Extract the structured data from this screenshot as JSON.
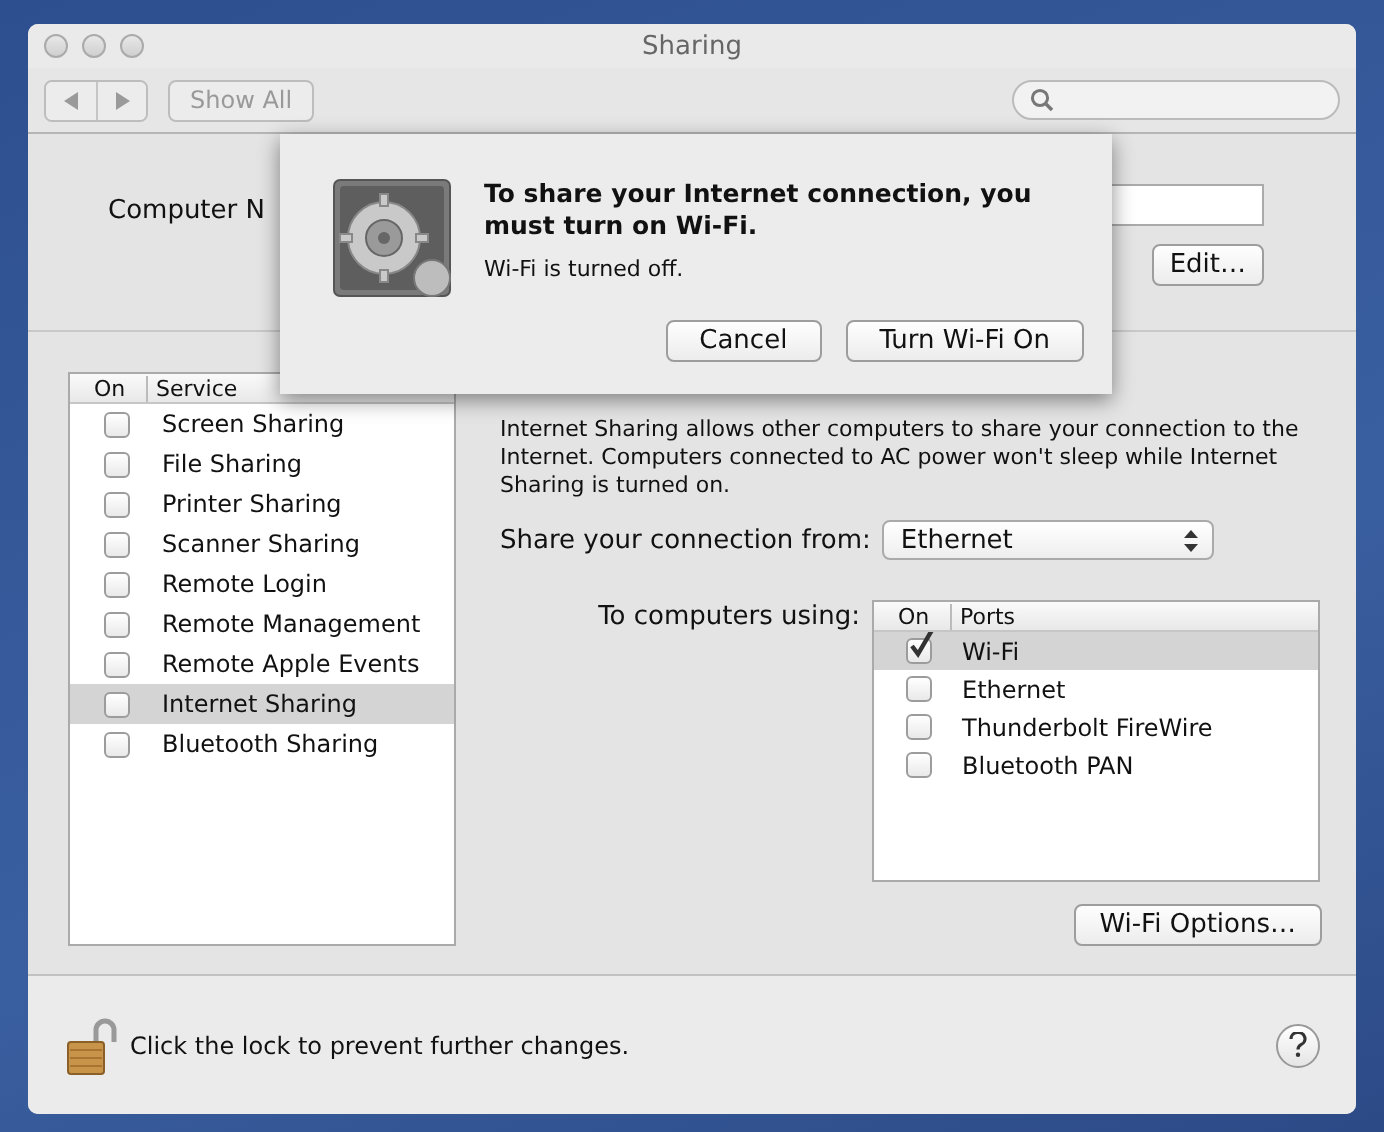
{
  "window": {
    "title": "Sharing"
  },
  "toolbar": {
    "show_all": "Show All"
  },
  "computer_name": {
    "label": "Computer N",
    "edit_button": "Edit…"
  },
  "alert": {
    "title": "To share your Internet connection, you must turn on Wi-Fi.",
    "message": "Wi-Fi is turned off.",
    "buttons": [
      {
        "label": "Cancel",
        "default": false
      },
      {
        "label": "Turn Wi-Fi On",
        "default": false
      }
    ]
  },
  "services": {
    "columns": [
      "On",
      "Service"
    ],
    "rows": [
      {
        "name": "Screen Sharing",
        "checked": false,
        "selected": false
      },
      {
        "name": "File Sharing",
        "checked": false,
        "selected": false
      },
      {
        "name": "Printer Sharing",
        "checked": false,
        "selected": false
      },
      {
        "name": "Scanner Sharing",
        "checked": false,
        "selected": false
      },
      {
        "name": "Remote Login",
        "checked": false,
        "selected": false
      },
      {
        "name": "Remote Management",
        "checked": false,
        "selected": false
      },
      {
        "name": "Remote Apple Events",
        "checked": false,
        "selected": false
      },
      {
        "name": "Internet Sharing",
        "checked": false,
        "selected": true
      },
      {
        "name": "Bluetooth Sharing",
        "checked": false,
        "selected": false
      }
    ]
  },
  "description": "Internet Sharing allows other computers to share your connection to the Internet. Computers connected to AC power won't sleep while Internet Sharing is turned on.",
  "share_from": {
    "label": "Share your connection from:",
    "value": "Ethernet"
  },
  "ports": {
    "label": "To computers using:",
    "columns": [
      "On",
      "Ports"
    ],
    "rows": [
      {
        "name": "Wi-Fi",
        "checked": true,
        "selected": true
      },
      {
        "name": "Ethernet",
        "checked": false,
        "selected": false
      },
      {
        "name": "Thunderbolt FireWire",
        "checked": false,
        "selected": false
      },
      {
        "name": "Bluetooth PAN",
        "checked": false,
        "selected": false
      }
    ]
  },
  "wifi_options_button": "Wi-Fi Options…",
  "footer": {
    "lock_text": "Click the lock to prevent further changes."
  }
}
